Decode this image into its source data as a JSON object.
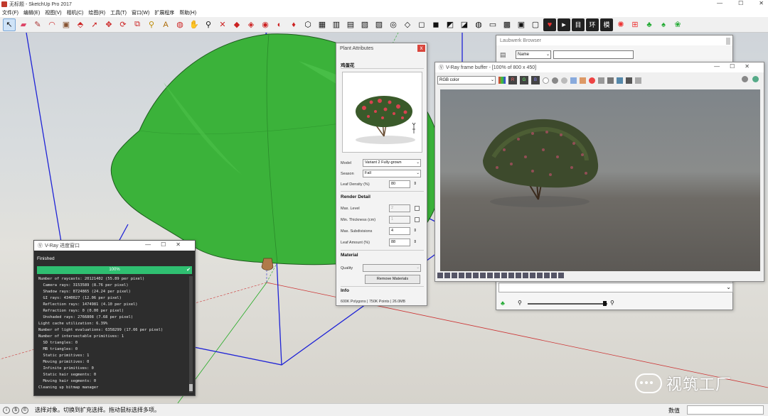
{
  "app": {
    "window_title": "无标题 - SketchUp Pro 2017",
    "win_controls": [
      "—",
      "☐",
      "✕"
    ]
  },
  "menu": [
    "文件(F)",
    "编辑(E)",
    "视图(V)",
    "相机(C)",
    "绘图(R)",
    "工具(T)",
    "窗口(W)",
    "扩展程序",
    "帮助(H)"
  ],
  "toolbar": {
    "tools": [
      "select-icon",
      "eraser-icon",
      "pencil-icon",
      "arc-icon",
      "paint-bucket-icon",
      "push-pull-icon",
      "follow-me-icon",
      "move-icon",
      "rotate-icon",
      "scale-icon",
      "tape-measure-icon",
      "text-icon",
      "orbit-icon",
      "pan-icon",
      "zoom-icon",
      "zoom-extents-icon"
    ],
    "right_labels": [
      "目",
      "环",
      "模"
    ]
  },
  "plant_attributes": {
    "title": "Plant Attributes",
    "close": "x",
    "plant_name": "鸡蛋花",
    "model_label": "Model",
    "model_value": "Variant 2 Fully-grown",
    "season_label": "Season",
    "season_value": "Fall",
    "leaf_density_label": "Leaf Density (%)",
    "leaf_density_value": "80",
    "render_detail": "Render Detail",
    "max_level_label": "Max. Level",
    "max_level_value": "2",
    "min_thickness_label": "Min. Thickness (cm)",
    "min_thickness_value": "1",
    "max_subdivisions_label": "Max. Subdivisions",
    "max_subdivisions_value": "4",
    "leaf_amount_label": "Leaf Amount (%)",
    "leaf_amount_value": "88",
    "material": "Material",
    "quality_label": "Quality",
    "remove_materials": "Remove Materials",
    "info": "Info",
    "info_text": "600K Polygons | 750K Points | 26.0MB"
  },
  "laubwerk_browser": {
    "title": "Laubwerk Browser",
    "name_label": "Name"
  },
  "vfb": {
    "title": "V-Ray frame buffer - [100% of 800 x 450]",
    "channel": "RGB color",
    "rgb": [
      "R",
      "G",
      "B"
    ]
  },
  "vray_progress": {
    "title": "V-Ray 进度窗口",
    "status": "Finished",
    "percent": "100%",
    "log": [
      "Number of raycasts: 20121402 (55.89 per pixel)",
      "  Camera rays: 3153589 (8.76 per pixel)",
      "  Shadow rays: 8724865 (24.24 per pixel)",
      "  GI rays: 4340027 (12.06 per pixel)",
      "  Reflection rays: 1474981 (4.10 per pixel)",
      "  Refraction rays: 0 (0.00 per pixel)",
      "  Unshaded rays: 2766808 (7.68 per pixel)",
      "Light cache utilization: 6.39%",
      "Number of light evaluations: 6358299 (17.66 per pixel)",
      "Number of intersectable primitives: 1",
      "  SD triangles: 0",
      "  MB triangles: 0",
      "  Static primitives: 1",
      "  Moving primitives: 0",
      "  Infinite primitives: 0",
      "  Static hair segments: 0",
      "  Moving hair segments: 0",
      "Cleaning up bitmap manager"
    ]
  },
  "status": {
    "hint": "选择对象。切换到扩充选择。拖动鼠标选择多项。",
    "measure_label": "数值"
  },
  "watermark": "视筑工厂"
}
